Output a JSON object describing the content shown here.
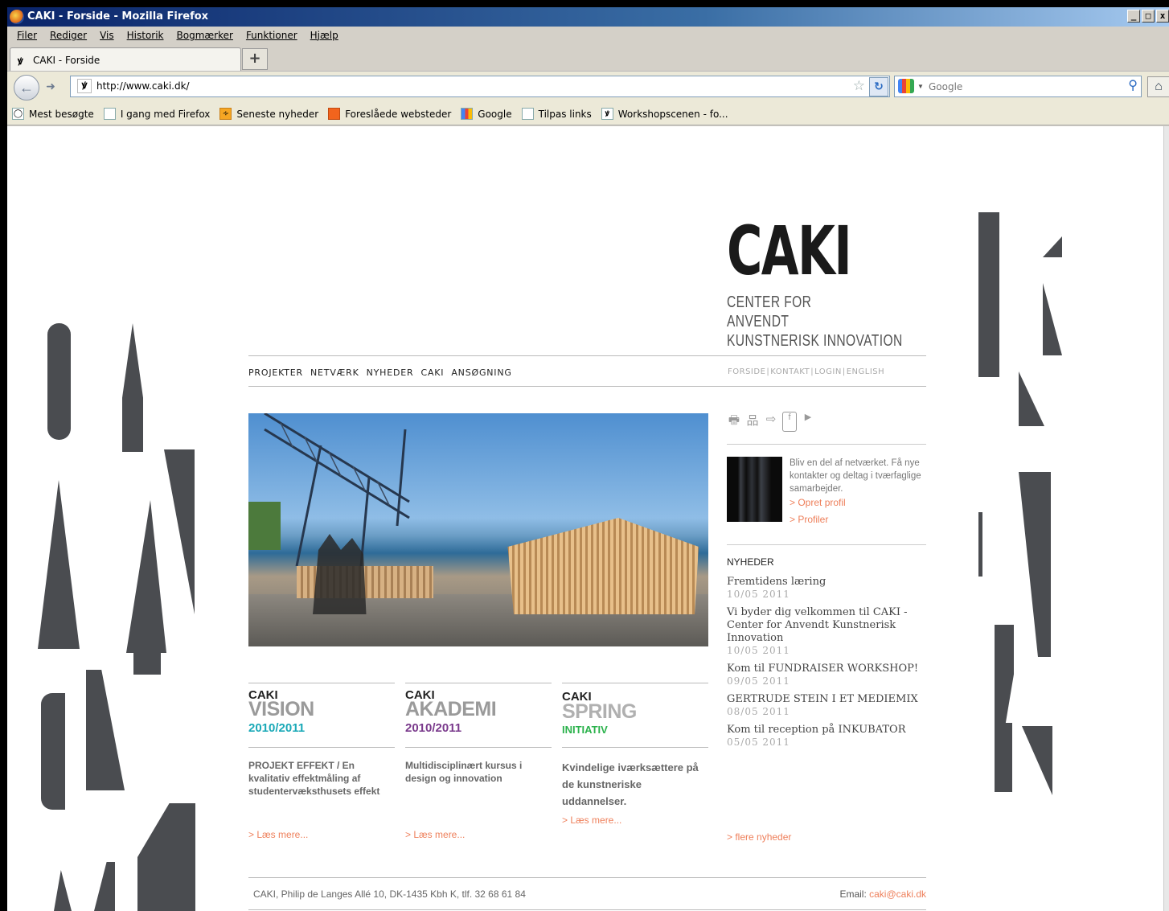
{
  "window": {
    "title": "CAKI - Forside - Mozilla Firefox",
    "controls": [
      "_",
      "□",
      "x"
    ]
  },
  "menu": [
    "Filer",
    "Rediger",
    "Vis",
    "Historik",
    "Bogmærker",
    "Funktioner",
    "Hjælp"
  ],
  "tab": {
    "label": "CAKI - Forside",
    "icon": "ꝟ",
    "new_tab": "+"
  },
  "nav": {
    "url": "http://www.caki.dk/",
    "search_engine": "Google"
  },
  "bookmarks": [
    "Mest besøgte",
    "I gang med Firefox",
    "Seneste nyheder",
    "Foreslåede websteder",
    "Google",
    "Tilpas links",
    "Workshopscenen - fo..."
  ],
  "logo": {
    "word": "CAKI",
    "tag1": "CENTER FOR",
    "tag2": "ANVENDT",
    "tag3": "KUNSTNERISK INNOVATION"
  },
  "main_nav": [
    "PROJEKTER",
    "NETVÆRK",
    "NYHEDER",
    "CAKI",
    "ANSØGNING"
  ],
  "top_nav": [
    "FORSIDE",
    "KONTAKT",
    "LOGIN",
    "ENGLISH"
  ],
  "columns": [
    {
      "k1": "CAKI",
      "k2": "VISION",
      "k3": "2010/2011",
      "k2_color": "#9a9a9a",
      "k3_color": "#1aa9b7",
      "desc": "PROJEKT EFFEKT / En kvalitativ effektmåling af studentervæksthusets effekt",
      "more": "> Læs mere..."
    },
    {
      "k1": "CAKI",
      "k2": "AKADEMI",
      "k3": "2010/2011",
      "k2_color": "#9a9a9a",
      "k3_color": "#7a3a8c",
      "desc": "Multidisciplinært kursus i design og innovation",
      "more": "> Læs mere..."
    },
    {
      "k1": "CAKI",
      "k2": "SPRING",
      "k3": "INITIATIV",
      "k2_color": "#b0b0b0",
      "k3_color": "#2bb24c",
      "desc": "Kvindelige iværksættere på de kunstneriske uddannelser.",
      "more": "> Læs mere..."
    }
  ],
  "sidebar": {
    "icons": [
      "printer-icon",
      "sitemap-icon",
      "rss-icon",
      "facebook-icon",
      "youtube-icon"
    ],
    "icon_glyphs": [
      "🖶",
      "品",
      "⇨",
      "f",
      "▶"
    ],
    "intro": "Bliv en del af netværket. Få nye kontakter og deltag i tværfaglige samarbejder.",
    "link1": "> Opret profil",
    "link2": "> Profiler",
    "news_heading": "NYHEDER",
    "news": [
      {
        "title": "Fremtidens læring",
        "date": "10/05 2011"
      },
      {
        "title": "Vi byder dig velkommen til CAKI - Center for Anvendt Kunstnerisk Innovation",
        "date": "10/05 2011"
      },
      {
        "title": "Kom til FUNDRAISER WORKSHOP!",
        "date": "09/05 2011"
      },
      {
        "title": "GERTRUDE STEIN I ET MEDIEMIX",
        "date": "08/05 2011"
      },
      {
        "title": "Kom til reception på INKUBATOR",
        "date": "05/05 2011"
      }
    ],
    "more_news": "> flere nyheder"
  },
  "footer": {
    "address": "CAKI, Philip de Langes Allé 10, DK-1435 Kbh K, tlf. 32 68 61 84",
    "email_label": "Email:",
    "email": "caki@caki.dk"
  },
  "colors": {
    "accent": "#ee7f5a",
    "deco": "#4a4c50"
  }
}
